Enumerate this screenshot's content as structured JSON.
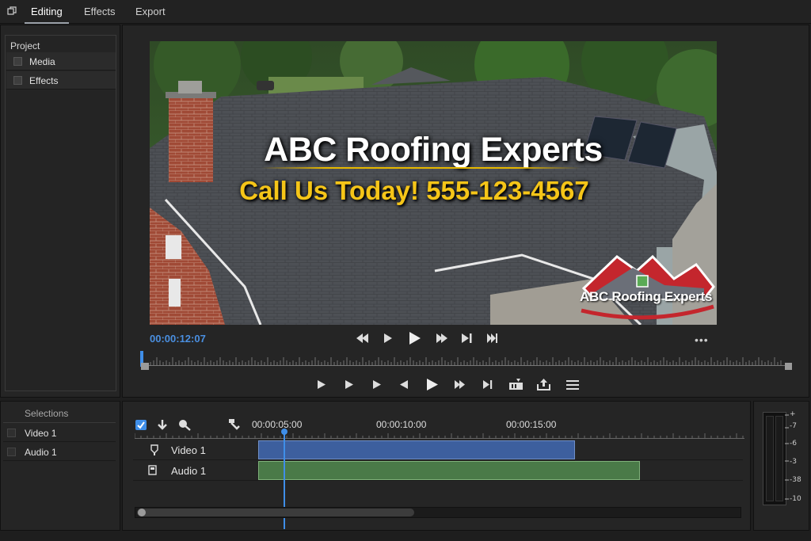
{
  "menu": {
    "tabs": [
      "Editing",
      "Effects",
      "Export"
    ]
  },
  "project": {
    "title": "Project",
    "items": [
      "Media",
      "Effects"
    ]
  },
  "preview": {
    "title": "ABC Roofing Experts",
    "subtitle": "Call Us Today! 555-123-4567",
    "logo_text": "ABC Roofing Experts",
    "timecode": "00:00:12:07",
    "more": "•••"
  },
  "sequence": {
    "title": "Selections",
    "items": [
      "Video 1",
      "Audio 1"
    ]
  },
  "timeline": {
    "times": [
      "00:00:05:00",
      "00:00:10:00",
      "00:00:15:00"
    ],
    "tracks": [
      "Video 1",
      "Audio 1"
    ]
  },
  "meter": {
    "labels": [
      "+",
      "-7",
      "-6",
      "-3",
      "-38",
      "-10"
    ]
  },
  "colors": {
    "accent": "#3f8ee8",
    "video_clip": "#3d5f9e",
    "audio_clip": "#4a7a48",
    "title_yellow": "#f5c518"
  }
}
